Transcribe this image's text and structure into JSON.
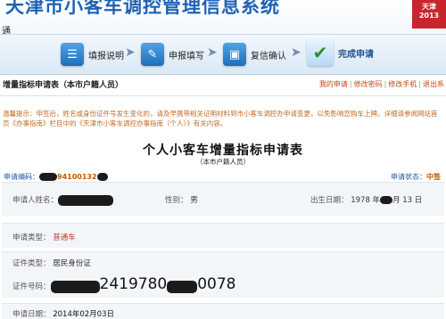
{
  "header": {
    "title": "天津市小客车调控管理信息系统",
    "subtitle": "通",
    "logo_text": "天津 2013"
  },
  "steps": [
    {
      "label": "填报说明",
      "icon": "document-list-icon"
    },
    {
      "label": "申报填写",
      "icon": "form-edit-icon"
    },
    {
      "label": "复信确认",
      "icon": "confirm-icon"
    },
    {
      "label": "完成申请",
      "icon": "checkmark-icon"
    }
  ],
  "page": {
    "title": "增量指标申请表（本市户籍人员）",
    "links": [
      "我的申请",
      "修改密码",
      "修改手机",
      "退出系"
    ]
  },
  "tip": "温馨提示：申签后，姓名或身份证件号发生变化的，请及早携带相关证明材料到市小客车调控办申请变更，以免影响您购车上牌。详细请参阅网站首页《办事指南》栏目中的《天津市小客车调控办事指南（个人）》有关内容。",
  "form": {
    "title": "个人小客车增量指标申请表",
    "subtitle": "（本市户籍人员）",
    "code_label": "申请编码：",
    "code_value": "94100132",
    "status_label": "申请状态：",
    "status_value": "中签",
    "applicant_label": "申请人姓名：",
    "gender_label": "性别：",
    "gender_value": "男",
    "birth_label": "出生日期：",
    "birth_year": "1978 年",
    "birth_day": "月 13 日",
    "type_label": "申请类型：",
    "type_value": "普通车",
    "idtype_label": "证件类型：",
    "idtype_value": "居民身份证",
    "idno_label": "证件号码：",
    "idno_part1": "2419780",
    "idno_part2": "0078",
    "date_label": "申请日期：",
    "date_value": "2014年02月03日"
  }
}
